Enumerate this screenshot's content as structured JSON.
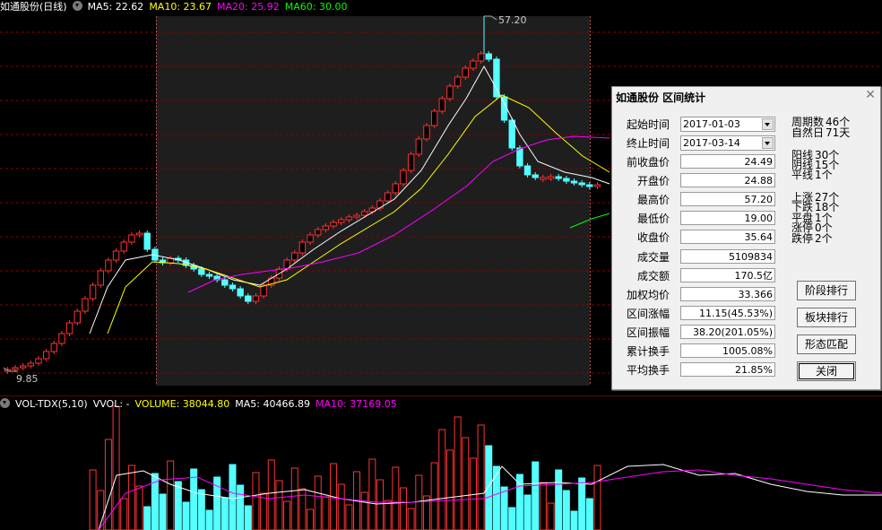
{
  "header": {
    "title": "如通股份(日线)",
    "ma5": "MA5: 22.62",
    "ma10": "MA10: 23.67",
    "ma20": "MA20: 25.92",
    "ma60": "MA60: 30.00"
  },
  "price_labels": {
    "max": "57.20",
    "min": "9.85"
  },
  "volume_header": {
    "title": "VOL-TDX(5,10)",
    "vvol": "VVOL: -",
    "volume": "VOLUME: 38044.80",
    "ma5": "MA5: 40466.89",
    "ma10": "MA10: 37169.05"
  },
  "colors": {
    "up": "#ff3232",
    "down": "#54ffff",
    "ma5": "#ffffff",
    "ma10": "#ffff00",
    "ma20": "#ff00ff",
    "ma60": "#00ff00",
    "grid": "#8b0000",
    "selection_bg": "#1e1e1e"
  },
  "dialog": {
    "title": "如通股份 区间统计",
    "close_icon": "close-icon",
    "start_label": "起始时间",
    "start_value": "2017-01-03",
    "end_label": "终止时间",
    "end_value": "2017-03-14",
    "fields": [
      {
        "label": "前收盘价",
        "value": "24.49"
      },
      {
        "label": "开盘价",
        "value": "24.88"
      },
      {
        "label": "最高价",
        "value": "57.20"
      },
      {
        "label": "最低价",
        "value": "19.00"
      },
      {
        "label": "收盘价",
        "value": "35.64"
      },
      {
        "label": "成交量",
        "value": "5109834"
      },
      {
        "label": "成交额",
        "value": "170.5亿"
      },
      {
        "label": "加权均价",
        "value": "33.366"
      },
      {
        "label": "区间涨幅",
        "value": "11.15(45.53%)"
      },
      {
        "label": "区间振幅",
        "value": "38.20(201.05%)"
      },
      {
        "label": "累计换手",
        "value": "1005.08%"
      },
      {
        "label": "平均换手",
        "value": "21.85%"
      }
    ],
    "stats": [
      {
        "label": "周期数",
        "value": "46个"
      },
      {
        "label": "自然日",
        "value": "71天"
      },
      {
        "label": "阳线",
        "value": "30个"
      },
      {
        "label": "阴线",
        "value": "15个"
      },
      {
        "label": "平线",
        "value": "1个"
      },
      {
        "label": "上涨",
        "value": "27个"
      },
      {
        "label": "下跌",
        "value": "18个"
      },
      {
        "label": "平盘",
        "value": "1个"
      },
      {
        "label": "涨停",
        "value": "0个"
      },
      {
        "label": "跌停",
        "value": "2个"
      }
    ],
    "buttons": [
      "阶段排行",
      "板块排行",
      "形态匹配",
      "关闭"
    ]
  }
}
